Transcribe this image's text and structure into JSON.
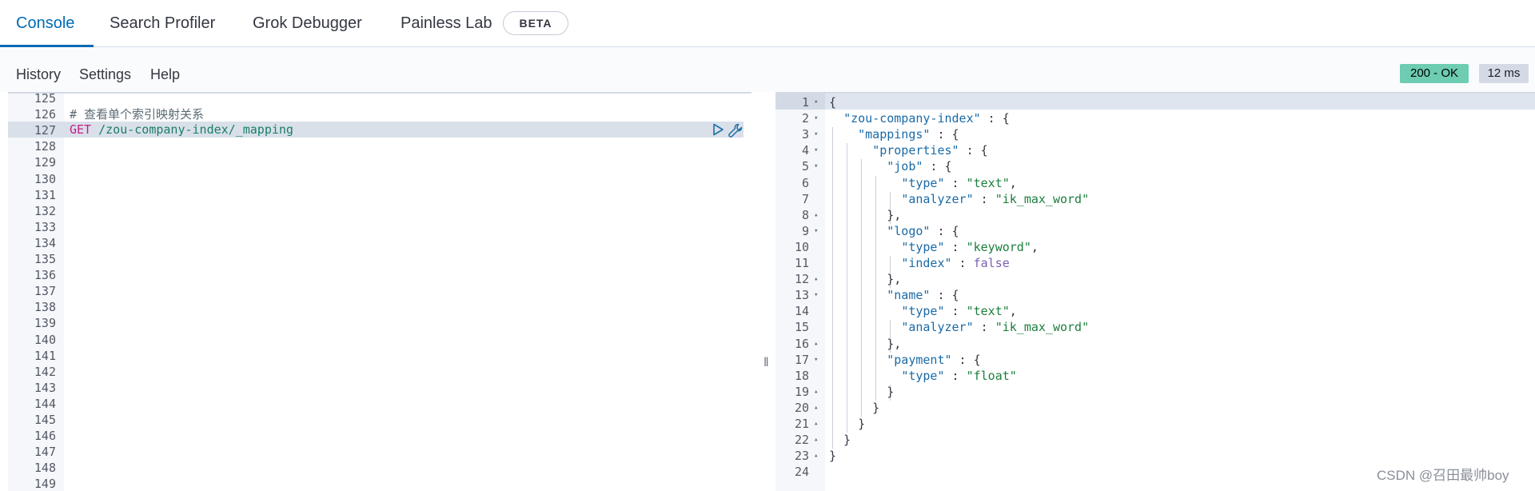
{
  "tabs": [
    "Console",
    "Search Profiler",
    "Grok Debugger",
    "Painless Lab"
  ],
  "beta_badge": "BETA",
  "toolbar": {
    "history": "History",
    "settings": "Settings",
    "help": "Help"
  },
  "status": {
    "code": "200 - OK",
    "time": "12 ms"
  },
  "request_editor": {
    "line_numbers": [
      "125",
      "126",
      "127",
      "128",
      "129",
      "130",
      "131",
      "132",
      "133",
      "134",
      "135",
      "136",
      "137",
      "138",
      "139",
      "140",
      "141",
      "142",
      "143",
      "144",
      "145",
      "146",
      "147",
      "148",
      "149"
    ],
    "comment": "# 查看单个索引映射关系",
    "method": "GET",
    "path": "/zou-company-index/_mapping",
    "active_line": "127"
  },
  "response_editor": {
    "line_numbers": [
      "1",
      "2",
      "3",
      "4",
      "5",
      "6",
      "7",
      "8",
      "9",
      "10",
      "11",
      "12",
      "13",
      "14",
      "15",
      "16",
      "17",
      "18",
      "19",
      "20",
      "21",
      "22",
      "23",
      "24"
    ],
    "fold_markers": [
      "▾",
      "▾",
      "▾",
      "▾",
      "▾",
      "",
      "",
      "▴",
      "▾",
      "",
      "",
      "▴",
      "▾",
      "",
      "",
      "▴",
      "▾",
      "",
      "▴",
      "▴",
      "▴",
      "▴",
      "▴",
      ""
    ],
    "lines": [
      [
        [
          "p",
          "{"
        ]
      ],
      [
        [
          "p",
          "  "
        ],
        [
          "k",
          "\"zou-company-index\""
        ],
        [
          "p",
          " : {"
        ]
      ],
      [
        [
          "p",
          "    "
        ],
        [
          "k",
          "\"mappings\""
        ],
        [
          "p",
          " : {"
        ]
      ],
      [
        [
          "p",
          "      "
        ],
        [
          "k",
          "\"properties\""
        ],
        [
          "p",
          " : {"
        ]
      ],
      [
        [
          "p",
          "        "
        ],
        [
          "k",
          "\"job\""
        ],
        [
          "p",
          " : {"
        ]
      ],
      [
        [
          "p",
          "          "
        ],
        [
          "k",
          "\"type\""
        ],
        [
          "p",
          " : "
        ],
        [
          "s",
          "\"text\""
        ],
        [
          "p",
          ","
        ]
      ],
      [
        [
          "p",
          "          "
        ],
        [
          "k",
          "\"analyzer\""
        ],
        [
          "p",
          " : "
        ],
        [
          "s",
          "\"ik_max_word\""
        ]
      ],
      [
        [
          "p",
          "        },"
        ]
      ],
      [
        [
          "p",
          "        "
        ],
        [
          "k",
          "\"logo\""
        ],
        [
          "p",
          " : {"
        ]
      ],
      [
        [
          "p",
          "          "
        ],
        [
          "k",
          "\"type\""
        ],
        [
          "p",
          " : "
        ],
        [
          "s",
          "\"keyword\""
        ],
        [
          "p",
          ","
        ]
      ],
      [
        [
          "p",
          "          "
        ],
        [
          "k",
          "\"index\""
        ],
        [
          "p",
          " : "
        ],
        [
          "b",
          "false"
        ]
      ],
      [
        [
          "p",
          "        },"
        ]
      ],
      [
        [
          "p",
          "        "
        ],
        [
          "k",
          "\"name\""
        ],
        [
          "p",
          " : {"
        ]
      ],
      [
        [
          "p",
          "          "
        ],
        [
          "k",
          "\"type\""
        ],
        [
          "p",
          " : "
        ],
        [
          "s",
          "\"text\""
        ],
        [
          "p",
          ","
        ]
      ],
      [
        [
          "p",
          "          "
        ],
        [
          "k",
          "\"analyzer\""
        ],
        [
          "p",
          " : "
        ],
        [
          "s",
          "\"ik_max_word\""
        ]
      ],
      [
        [
          "p",
          "        },"
        ]
      ],
      [
        [
          "p",
          "        "
        ],
        [
          "k",
          "\"payment\""
        ],
        [
          "p",
          " : {"
        ]
      ],
      [
        [
          "p",
          "          "
        ],
        [
          "k",
          "\"type\""
        ],
        [
          "p",
          " : "
        ],
        [
          "s",
          "\"float\""
        ]
      ],
      [
        [
          "p",
          "        }"
        ]
      ],
      [
        [
          "p",
          "      }"
        ]
      ],
      [
        [
          "p",
          "    }"
        ]
      ],
      [
        [
          "p",
          "  }"
        ]
      ],
      [
        [
          "p",
          "}"
        ]
      ],
      []
    ]
  },
  "watermark": "CSDN @召田最帅boy"
}
